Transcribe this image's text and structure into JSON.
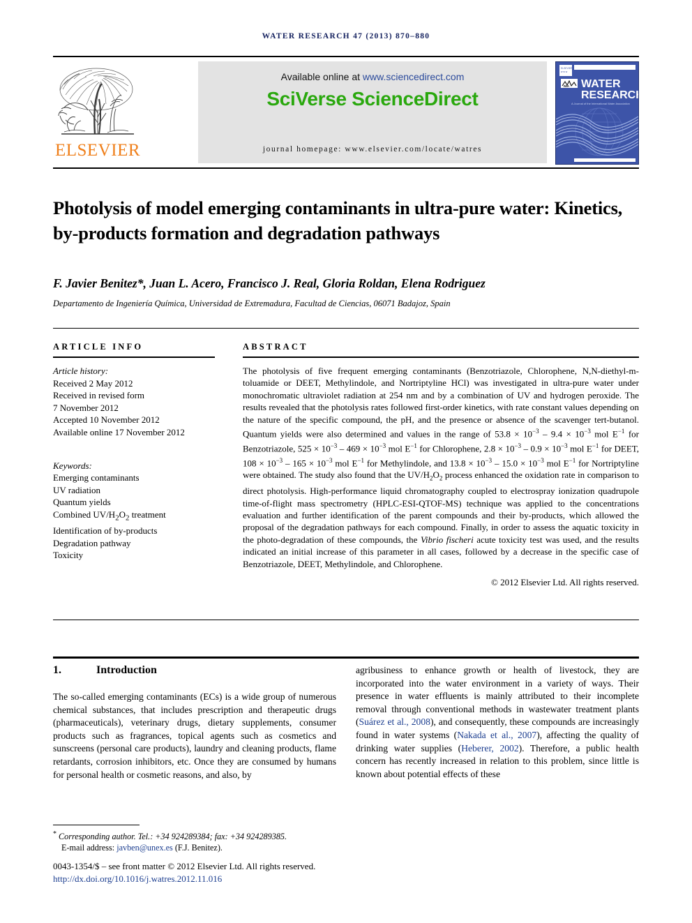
{
  "running_head": "WATER RESEARCH 47 (2013) 870–880",
  "masthead": {
    "publisher_name": "ELSEVIER",
    "available_prefix": "Available online at ",
    "available_link": "www.sciencedirect.com",
    "sciencedirect_logo": "SciVerse ScienceDirect",
    "journal_homepage": "journal homepage: www.elsevier.com/locate/watres",
    "cover": {
      "title_line1": "WATER",
      "title_line2": "RESEARCH",
      "subtitle": "A Journal of the International Water Association",
      "badge": "IWA",
      "accent": "#3d54a8"
    }
  },
  "article": {
    "title": "Photolysis of model emerging contaminants in ultra-pure water: Kinetics, by-products formation and degradation pathways",
    "authors": "F. Javier Benitez*, Juan L. Acero, Francisco J. Real, Gloria Roldan, Elena Rodriguez",
    "affiliation": "Departamento de Ingeniería Química, Universidad de Extremadura, Facultad de Ciencias, 06071 Badajoz, Spain"
  },
  "article_info": {
    "heading": "ARTICLE INFO",
    "history_label": "Article history:",
    "history": [
      "Received 2 May 2012",
      "Received in revised form",
      "7 November 2012",
      "Accepted 10 November 2012",
      "Available online 17 November 2012"
    ],
    "keywords_label": "Keywords:",
    "keywords": [
      "Emerging contaminants",
      "UV radiation",
      "Quantum yields",
      "Combined UV/H2O2 treatment",
      "Identification of by-products",
      "Degradation pathway",
      "Toxicity"
    ]
  },
  "abstract": {
    "heading": "ABSTRACT",
    "paragraph_html": "The photolysis of five frequent emerging contaminants (Benzotriazole, Chlorophene, N,N-diethyl-m-toluamide or DEET, Methylindole, and Nortriptyline HCl) was investigated in ultra-pure water under monochromatic ultraviolet radiation at 254 nm and by a combination of UV and hydrogen peroxide. The results revealed that the photolysis rates followed first-order kinetics, with rate constant values depending on the nature of the specific compound, the pH, and the presence or absence of the scavenger tert-butanol. Quantum yields were also determined and values in the range of 53.8 × 10<sup>−3</sup> – 9.4 × 10<sup>−3</sup> mol E<sup>−1</sup> for Benzotriazole, 525 × 10<sup>−3</sup> – 469 × 10<sup>−3</sup> mol E<sup>−1</sup> for Chlorophene, 2.8 × 10<sup>−3</sup> – 0.9 × 10<sup>−3</sup> mol E<sup>−1</sup> for DEET, 108 × 10<sup>−3</sup> – 165 × 10<sup>−3</sup> mol E<sup>−1</sup> for Methylindole, and 13.8 × 10<sup>−3</sup> – 15.0 × 10<sup>−3</sup> mol E<sup>−1</sup> for Nortriptyline were obtained. The study also found that the UV/H<sub>2</sub>O<sub>2</sub> process enhanced the oxidation rate in comparison to direct photolysis. High-performance liquid chromatography coupled to electrospray ionization quadrupole time-of-flight mass spectrometry (HPLC-ESI-QTOF-MS) technique was applied to the concentrations evaluation and further identification of the parent compounds and their by-products, which allowed the proposal of the degradation pathways for each compound. Finally, in order to assess the aquatic toxicity in the photo-degradation of these compounds, the <i>Vibrio fischeri</i> acute toxicity test was used, and the results indicated an initial increase of this parameter in all cases, followed by a decrease in the specific case of Benzotriazole, DEET, Methylindole, and Chlorophene.",
    "copyright": "© 2012 Elsevier Ltd. All rights reserved."
  },
  "introduction": {
    "number": "1.",
    "heading": "Introduction",
    "left_paragraph": "The so-called emerging contaminants (ECs) is a wide group of numerous chemical substances, that includes prescription and therapeutic drugs (pharmaceuticals), veterinary drugs, dietary supplements, consumer products such as fragrances, topical agents such as cosmetics and sunscreens (personal care products), laundry and cleaning products, flame retardants, corrosion inhibitors, etc. Once they are consumed by humans for personal health or cosmetic reasons, and also, by",
    "right_paragraph_html": "agribusiness to enhance growth or health of livestock, they are incorporated into the water environment in a variety of ways. Their presence in water effluents is mainly attributed to their incomplete removal through conventional methods in wastewater treatment plants (<span class=\"cite\">Suárez et al., 2008</span>), and consequently, these compounds are increasingly found in water systems (<span class=\"cite\">Nakada et al., 2007</span>), affecting the quality of drinking water supplies (<span class=\"cite\">Heberer, 2002</span>). Therefore, a public health concern has recently increased in relation to this problem, since little is known about potential effects of these"
  },
  "footer": {
    "corresponding_marker": "*",
    "corresponding_text": "Corresponding author. Tel.: +34 924289384; fax: +34 924289385.",
    "email_label": "E-mail address: ",
    "email": "javben@unex.es",
    "email_suffix": " (F.J. Benitez).",
    "imprint": "0043-1354/$ – see front matter © 2012 Elsevier Ltd. All rights reserved.",
    "doi": "http://dx.doi.org/10.1016/j.watres.2012.11.016"
  }
}
